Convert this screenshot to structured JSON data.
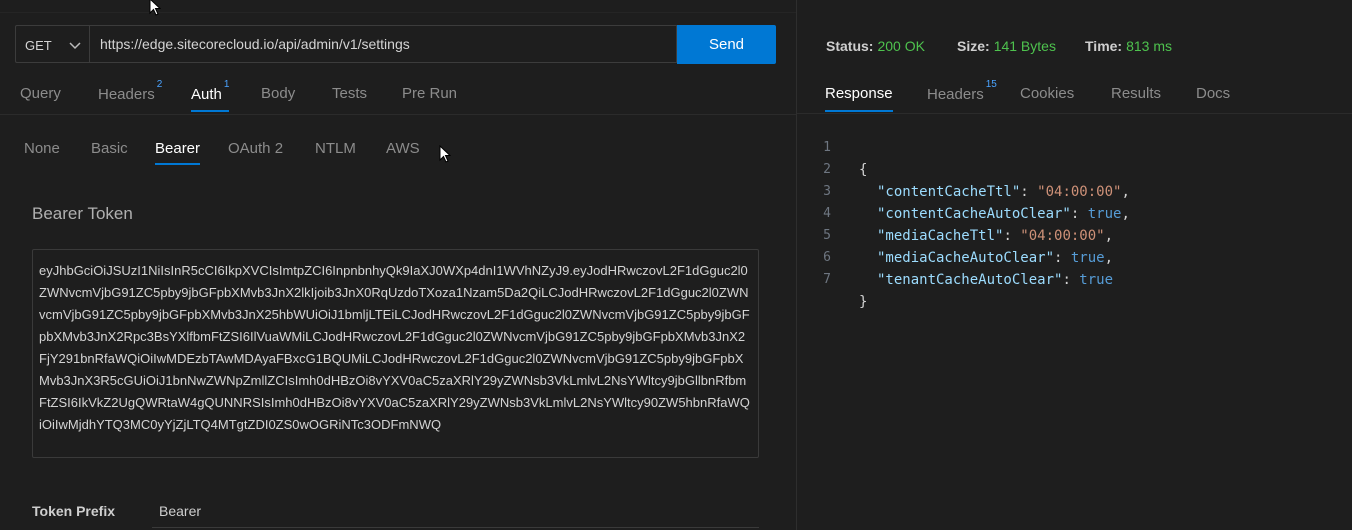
{
  "request": {
    "method": "GET",
    "url": "https://edge.sitecorecloud.io/api/admin/v1/settings",
    "send_label": "Send"
  },
  "request_tabs": [
    {
      "label": "Query",
      "count": ""
    },
    {
      "label": "Headers",
      "count": "2"
    },
    {
      "label": "Auth",
      "count": "1",
      "active": true
    },
    {
      "label": "Body",
      "count": ""
    },
    {
      "label": "Tests",
      "count": ""
    },
    {
      "label": "Pre Run",
      "count": ""
    }
  ],
  "auth_tabs": [
    {
      "label": "None"
    },
    {
      "label": "Basic"
    },
    {
      "label": "Bearer",
      "active": true
    },
    {
      "label": "OAuth 2"
    },
    {
      "label": "NTLM"
    },
    {
      "label": "AWS"
    }
  ],
  "bearer": {
    "title": "Bearer Token",
    "token": "eyJhbGciOiJSUzI1NiIsInR5cCI6IkpXVCIsImtpZCI6InpnbnhyQk9IaXJ0WXp4dnI1WVhNZyJ9.eyJodHRwczovL2F1dGguc2l0ZWNvcmVjbG91ZC5pby9jbGFpbXMvb3JnX2lkIjoib3JnX0RqUzdoTXoza1Nzam5Da2QiLCJodHRwczovL2F1dGguc2l0ZWNvcmVjbG91ZC5pby9jbGFpbXMvb3JnX25hbWUiOiJ1bmljLTEiLCJodHRwczovL2F1dGguc2l0ZWNvcmVjbG91ZC5pby9jbGFpbXMvb3JnX2Rpc3BsYXlfbmFtZSI6IlVuaWMiLCJodHRwczovL2F1dGguc2l0ZWNvcmVjbG91ZC5pby9jbGFpbXMvb3JnX2FjY291bnRfaWQiOiIwMDEzbTAwMDAyaFBxcG1BQUMiLCJodHRwczovL2F1dGguc2l0ZWNvcmVjbG91ZC5pby9jbGFpbXMvb3JnX3R5cGUiOiJ1bnNwZWNpZmllZCIsImh0dHBzOi8vYXV0aC5zaXRlY29yZWNsb3VkLmlvL2NsYWltcy9jbGllbnRfbmFtZSI6IkVkZ2UgQWRtaW4gQUNNRSIsImh0dHBzOi8vYXV0aC5zaXRlY29yZWNsb3VkLmlvL2NsYWltcy90ZW5hbnRfaWQiOiIwMjdhYTQ3MC0yYjZjLTQ4MTgtZDI0ZS0wOGRiNTc3ODFmNWQ",
    "prefix_label": "Token Prefix",
    "prefix_value": "Bearer"
  },
  "response": {
    "status_label": "Status:",
    "status_value": "200 OK",
    "size_label": "Size:",
    "size_value": "141 Bytes",
    "time_label": "Time:",
    "time_value": "813 ms",
    "status_color": "#4ec24e",
    "tabs": [
      {
        "label": "Response",
        "count": "",
        "active": true
      },
      {
        "label": "Headers",
        "count": "15"
      },
      {
        "label": "Cookies",
        "count": ""
      },
      {
        "label": "Results",
        "count": ""
      },
      {
        "label": "Docs",
        "count": ""
      }
    ],
    "line_numbers": [
      "1",
      "2",
      "3",
      "4",
      "5",
      "6",
      "7"
    ],
    "lines": [
      {
        "punct_open": "{"
      },
      {
        "key": "\"contentCacheTtl\"",
        "value": "\"04:00:00\"",
        "type": "string",
        "trail": ","
      },
      {
        "key": "\"contentCacheAutoClear\"",
        "value": "true",
        "type": "bool",
        "trail": ","
      },
      {
        "key": "\"mediaCacheTtl\"",
        "value": "\"04:00:00\"",
        "type": "string",
        "trail": ","
      },
      {
        "key": "\"mediaCacheAutoClear\"",
        "value": "true",
        "type": "bool",
        "trail": ","
      },
      {
        "key": "\"tenantCacheAutoClear\"",
        "value": "true",
        "type": "bool",
        "trail": ""
      },
      {
        "punct_close": "}"
      }
    ]
  },
  "colors": {
    "accent": "#0078d4",
    "background": "#1e1e1e",
    "count_badge": "#4aa3ff",
    "json_key": "#9cdcfe",
    "json_string": "#ce9178",
    "json_bool": "#569cd6"
  }
}
